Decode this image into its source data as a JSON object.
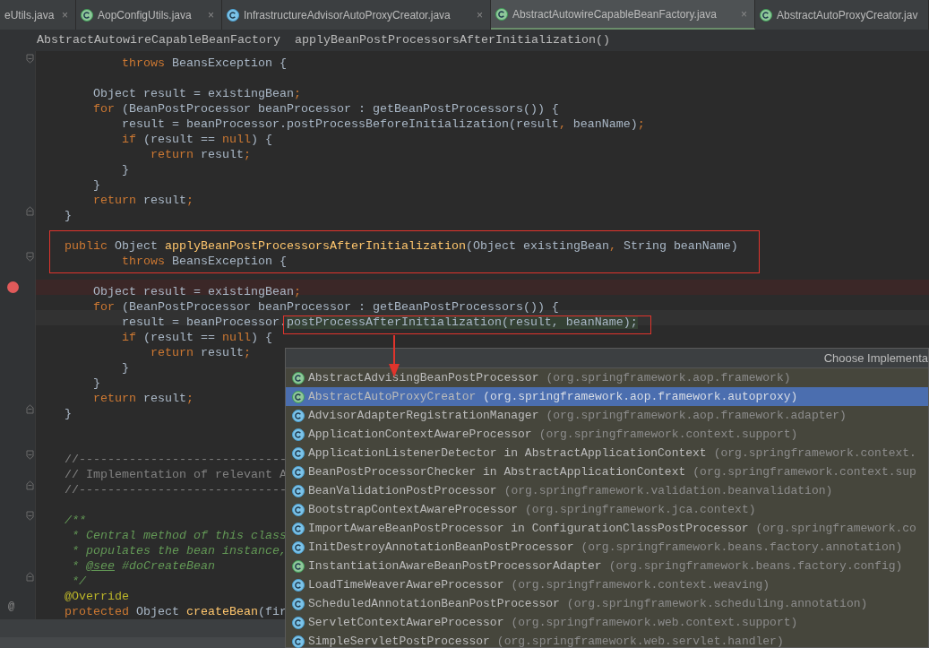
{
  "tabs": [
    {
      "label": "eUtils.java",
      "close": "×",
      "selected": false
    },
    {
      "kind": "abstract",
      "label": "AopConfigUtils.java",
      "close": "×",
      "selected": false
    },
    {
      "kind": "class",
      "label": "InfrastructureAdvisorAutoProxyCreator.java",
      "close": "×",
      "selected": false
    },
    {
      "kind": "abstract",
      "label": "AbstractAutowireCapableBeanFactory.java",
      "close": "×",
      "selected": true
    },
    {
      "kind": "abstract",
      "label": "AbstractAutoProxyCreator.jav",
      "selected": false
    }
  ],
  "breadcrumbs": [
    "AbstractAutowireCapableBeanFactory",
    "applyBeanPostProcessorsAfterInitialization()"
  ],
  "editor": {
    "lines": [
      {
        "kind": "code",
        "fold_start": true,
        "tokens": [
          {
            "kind": "kw",
            "text": "            throws"
          },
          {
            "kind": "id",
            "text": " BeansException {"
          }
        ]
      },
      {
        "kind": "blank"
      },
      {
        "kind": "code",
        "tokens": [
          {
            "kind": "id",
            "text": "        Object result = existingBean"
          },
          {
            "kind": "kw",
            "text": ";"
          }
        ]
      },
      {
        "kind": "code",
        "tokens": [
          {
            "kind": "kw",
            "text": "        for"
          },
          {
            "kind": "id",
            "text": " (BeanPostProcessor beanProcessor : getBeanPostProcessors()) {"
          }
        ]
      },
      {
        "kind": "code",
        "tokens": [
          {
            "kind": "id",
            "text": "            result = beanProcessor.postProcessBeforeInitialization(result"
          },
          {
            "kind": "kw",
            "text": ","
          },
          {
            "kind": "id",
            "text": " beanName)"
          },
          {
            "kind": "kw",
            "text": ";"
          }
        ]
      },
      {
        "kind": "code",
        "tokens": [
          {
            "kind": "kw",
            "text": "            if"
          },
          {
            "kind": "id",
            "text": " (result == "
          },
          {
            "kind": "kw",
            "text": "null"
          },
          {
            "kind": "id",
            "text": ") {"
          }
        ]
      },
      {
        "kind": "code",
        "tokens": [
          {
            "kind": "kw",
            "text": "                return"
          },
          {
            "kind": "id",
            "text": " result"
          },
          {
            "kind": "kw",
            "text": ";"
          }
        ]
      },
      {
        "kind": "code",
        "tokens": [
          {
            "kind": "id",
            "text": "            }"
          }
        ]
      },
      {
        "kind": "code",
        "tokens": [
          {
            "kind": "id",
            "text": "        }"
          }
        ]
      },
      {
        "kind": "code",
        "tokens": [
          {
            "kind": "kw",
            "text": "        return"
          },
          {
            "kind": "id",
            "text": " result"
          },
          {
            "kind": "kw",
            "text": ";"
          }
        ]
      },
      {
        "kind": "code",
        "fold_end": true,
        "tokens": [
          {
            "kind": "id",
            "text": "    }"
          }
        ]
      },
      {
        "kind": "blank"
      },
      {
        "kind": "code",
        "tokens": [
          {
            "kind": "kw",
            "text": "    public"
          },
          {
            "kind": "id",
            "text": " Object "
          },
          {
            "kind": "fn",
            "text": "applyBeanPostProcessorsAfterInitialization"
          },
          {
            "kind": "id",
            "text": "(Object existingBean"
          },
          {
            "kind": "kw",
            "text": ","
          },
          {
            "kind": "id",
            "text": " String beanName)"
          }
        ]
      },
      {
        "kind": "code",
        "fold_start": true,
        "tokens": [
          {
            "kind": "kw",
            "text": "            throws"
          },
          {
            "kind": "id",
            "text": " BeansException {"
          }
        ]
      },
      {
        "kind": "blank"
      },
      {
        "kind": "code",
        "breakpoint": true,
        "tokens": [
          {
            "kind": "id",
            "text": "        Object result = existingBean"
          },
          {
            "kind": "kw",
            "text": ";"
          }
        ]
      },
      {
        "kind": "code",
        "tokens": [
          {
            "kind": "kw",
            "text": "        for"
          },
          {
            "kind": "id",
            "text": " (BeanPostProcessor beanProcessor : getBeanPostProcessors()) {"
          }
        ]
      },
      {
        "kind": "code",
        "caret": true,
        "tokens": [
          {
            "kind": "id",
            "text": "            result = beanProcessor."
          },
          {
            "kind": "hl",
            "text": "postProcessAfterInitialization(result, beanName);"
          }
        ]
      },
      {
        "kind": "code",
        "tokens": [
          {
            "kind": "kw",
            "text": "            if"
          },
          {
            "kind": "id",
            "text": " (result == "
          },
          {
            "kind": "kw",
            "text": "null"
          },
          {
            "kind": "id",
            "text": ") {"
          }
        ]
      },
      {
        "kind": "code",
        "tokens": [
          {
            "kind": "kw",
            "text": "                return"
          },
          {
            "kind": "id",
            "text": " result"
          },
          {
            "kind": "kw",
            "text": ";"
          }
        ]
      },
      {
        "kind": "code",
        "tokens": [
          {
            "kind": "id",
            "text": "            }"
          }
        ]
      },
      {
        "kind": "code",
        "tokens": [
          {
            "kind": "id",
            "text": "        }"
          }
        ]
      },
      {
        "kind": "code",
        "tokens": [
          {
            "kind": "kw",
            "text": "        return"
          },
          {
            "kind": "id",
            "text": " result"
          },
          {
            "kind": "kw",
            "text": ";"
          }
        ]
      },
      {
        "kind": "code",
        "fold_end": true,
        "tokens": [
          {
            "kind": "id",
            "text": "    }"
          }
        ]
      },
      {
        "kind": "blank"
      },
      {
        "kind": "blank"
      },
      {
        "kind": "code",
        "fold_start": true,
        "tokens": [
          {
            "kind": "cm",
            "text": "    //-----------------------------"
          }
        ]
      },
      {
        "kind": "code",
        "tokens": [
          {
            "kind": "cm",
            "text": "    // Implementation of relevant A"
          }
        ]
      },
      {
        "kind": "code",
        "fold_end": true,
        "tokens": [
          {
            "kind": "cm",
            "text": "    //-----------------------------"
          }
        ]
      },
      {
        "kind": "blank"
      },
      {
        "kind": "code",
        "fold_start": true,
        "tokens": [
          {
            "kind": "doc",
            "text": "    /**"
          }
        ]
      },
      {
        "kind": "code",
        "tokens": [
          {
            "kind": "doc",
            "text": "     * Central method of this class"
          }
        ]
      },
      {
        "kind": "code",
        "tokens": [
          {
            "kind": "doc",
            "text": "     * populates the bean instance,"
          }
        ]
      },
      {
        "kind": "code",
        "tokens": [
          {
            "kind": "doc",
            "text": "     * "
          },
          {
            "kind": "tag",
            "text": "@see"
          },
          {
            "kind": "doc",
            "text": " #doCreateBean"
          }
        ]
      },
      {
        "kind": "code",
        "fold_end": true,
        "tokens": [
          {
            "kind": "doc",
            "text": "     */"
          }
        ]
      },
      {
        "kind": "code",
        "tokens": [
          {
            "kind": "ann",
            "text": "    @Override"
          }
        ]
      },
      {
        "kind": "code",
        "marker": "@",
        "tokens": [
          {
            "kind": "kw",
            "text": "    protected"
          },
          {
            "kind": "id",
            "text": " Object "
          },
          {
            "kind": "fn",
            "text": "createBean"
          },
          {
            "kind": "id",
            "text": "(fir"
          }
        ]
      }
    ]
  },
  "popup": {
    "title": "Choose Implementa",
    "items": [
      {
        "kind": "abstract",
        "name": "AbstractAdvisingBeanPostProcessor",
        "package": "(org.springframework.aop.framework)",
        "selected": false
      },
      {
        "kind": "abstract",
        "name": "AbstractAutoProxyCreator",
        "package": "(org.springframework.aop.framework.autoproxy)",
        "selected": true
      },
      {
        "kind": "class",
        "name": "AdvisorAdapterRegistrationManager",
        "package": "(org.springframework.aop.framework.adapter)",
        "selected": false
      },
      {
        "kind": "class",
        "name": "ApplicationContextAwareProcessor",
        "package": "(org.springframework.context.support)",
        "selected": false
      },
      {
        "kind": "class",
        "name": "ApplicationListenerDetector in AbstractApplicationContext",
        "package": "(org.springframework.context.",
        "selected": false
      },
      {
        "kind": "class",
        "name": "BeanPostProcessorChecker in AbstractApplicationContext",
        "package": "(org.springframework.context.sup",
        "selected": false
      },
      {
        "kind": "class",
        "name": "BeanValidationPostProcessor",
        "package": "(org.springframework.validation.beanvalidation)",
        "selected": false
      },
      {
        "kind": "class",
        "name": "BootstrapContextAwareProcessor",
        "package": "(org.springframework.jca.context)",
        "selected": false
      },
      {
        "kind": "class",
        "name": "ImportAwareBeanPostProcessor in ConfigurationClassPostProcessor",
        "package": "(org.springframework.co",
        "selected": false
      },
      {
        "kind": "class",
        "name": "InitDestroyAnnotationBeanPostProcessor",
        "package": "(org.springframework.beans.factory.annotation)",
        "selected": false
      },
      {
        "kind": "abstract",
        "name": "InstantiationAwareBeanPostProcessorAdapter",
        "package": "(org.springframework.beans.factory.config)",
        "selected": false
      },
      {
        "kind": "class",
        "name": "LoadTimeWeaverAwareProcessor",
        "package": "(org.springframework.context.weaving)",
        "selected": false
      },
      {
        "kind": "class",
        "name": "ScheduledAnnotationBeanPostProcessor",
        "package": "(org.springframework.scheduling.annotation)",
        "selected": false
      },
      {
        "kind": "class",
        "name": "ServletContextAwareProcessor",
        "package": "(org.springframework.web.context.support)",
        "selected": false
      },
      {
        "kind": "class",
        "name": "SimpleServletPostProcessor",
        "package": "(org.springframework.web.servlet.handler)",
        "selected": false
      }
    ]
  }
}
